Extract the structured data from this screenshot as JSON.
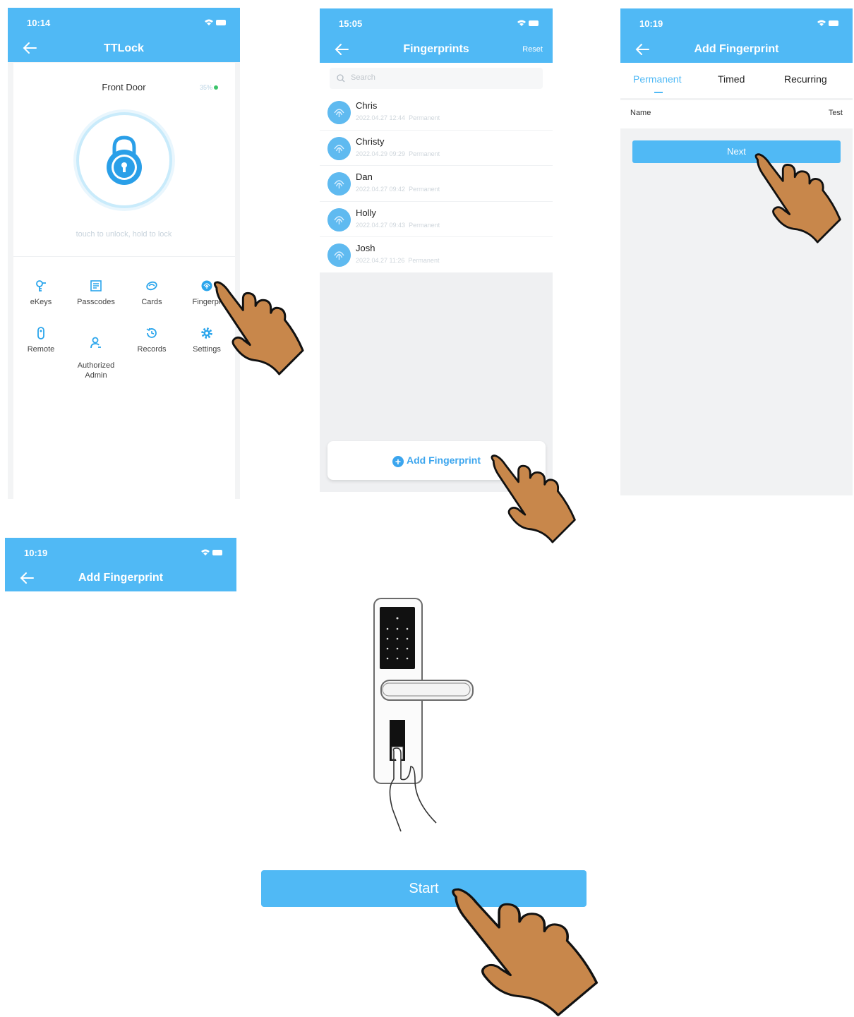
{
  "screen1": {
    "time": "10:14",
    "title": "TTLock",
    "door_name": "Front Door",
    "battery": "35%",
    "hint": "touch to unlock, hold to lock",
    "menu": [
      {
        "label": "eKeys",
        "icon": "key-icon"
      },
      {
        "label": "Passcodes",
        "icon": "passcode-icon"
      },
      {
        "label": "Cards",
        "icon": "card-icon"
      },
      {
        "label": "Fingerpr",
        "icon": "fingerprint-icon"
      },
      {
        "label": "Remote",
        "icon": "remote-icon"
      },
      {
        "label": "Authorized\nAdmin",
        "icon": "admin-icon"
      },
      {
        "label": "Records",
        "icon": "records-icon"
      },
      {
        "label": "Settings",
        "icon": "settings-icon"
      }
    ]
  },
  "screen2": {
    "time": "15:05",
    "title": "Fingerprints",
    "reset_label": "Reset",
    "search_placeholder": "Search",
    "items": [
      {
        "name": "Chris",
        "date": "2022.04.27 12:44",
        "type": "Permanent"
      },
      {
        "name": "Christy",
        "date": "2022.04.29 09:29",
        "type": "Permanent"
      },
      {
        "name": "Dan",
        "date": "2022.04.27 09:42",
        "type": "Permanent"
      },
      {
        "name": "Holly",
        "date": "2022.04.27 09:43",
        "type": "Permanent"
      },
      {
        "name": "Josh",
        "date": "2022.04.27 11:26",
        "type": "Permanent"
      }
    ],
    "add_label": "Add Fingerprint"
  },
  "screen3": {
    "time": "10:19",
    "title": "Add Fingerprint",
    "tabs": [
      "Permanent",
      "Timed",
      "Recurring"
    ],
    "active_tab": "Permanent",
    "name_label": "Name",
    "name_value": "Test",
    "next_label": "Next"
  },
  "screen4": {
    "time": "10:19",
    "title": "Add Fingerprint",
    "start_label": "Start"
  },
  "colors": {
    "accent": "#50b9f5",
    "hand_skin": "#c8874b"
  }
}
